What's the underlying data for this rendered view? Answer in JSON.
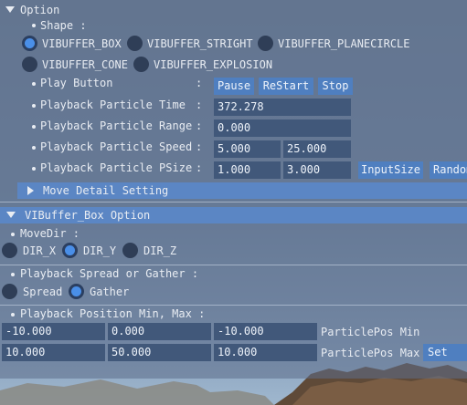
{
  "option": {
    "header": "Option",
    "shape_label": "Shape :",
    "shapes": [
      "VIBUFFER_BOX",
      "VIBUFFER_STRIGHT",
      "VIBUFFER_PLANECIRCLE",
      "VIBUFFER_CONE",
      "VIBUFFER_EXPLOSION"
    ],
    "shape_selected": "VIBUFFER_BOX",
    "play_button_label": "Play Button",
    "play_colon": ":",
    "pause": "Pause",
    "restart": "ReStart",
    "stop": "Stop",
    "time_label": "Playback Particle Time",
    "time_colon": ":",
    "time_value": "372.278",
    "range_label": "Playback Particle Range",
    "range_colon": ":",
    "range_value": "0.000",
    "speed_label": "Playback Particle Speed",
    "speed_colon": ":",
    "speed_min": "5.000",
    "speed_max": "25.000",
    "psize_label": "Playback Particle PSize",
    "psize_colon": ":",
    "psize_min": "1.000",
    "psize_max": "3.000",
    "input_size": "InputSize",
    "random": "Random",
    "move_detail": "Move Detail Setting"
  },
  "box_option": {
    "header": "VIBuffer_Box Option",
    "movedir_label": "MoveDir :",
    "dirs": [
      "DIR_X",
      "DIR_Y",
      "DIR_Z"
    ],
    "dir_selected": "DIR_Y",
    "spread_label": "Playback Spread or Gather :",
    "spread": "Spread",
    "gather": "Gather",
    "spread_selected": "Gather",
    "pos_label": "Playback Position Min, Max :",
    "pos_min": [
      "-10.000",
      "0.000",
      "-10.000"
    ],
    "pos_min_label": "ParticlePos Min",
    "pos_max": [
      "10.000",
      "50.000",
      "10.000"
    ],
    "pos_max_label": "ParticlePos Max",
    "set_box": "Set Box"
  }
}
